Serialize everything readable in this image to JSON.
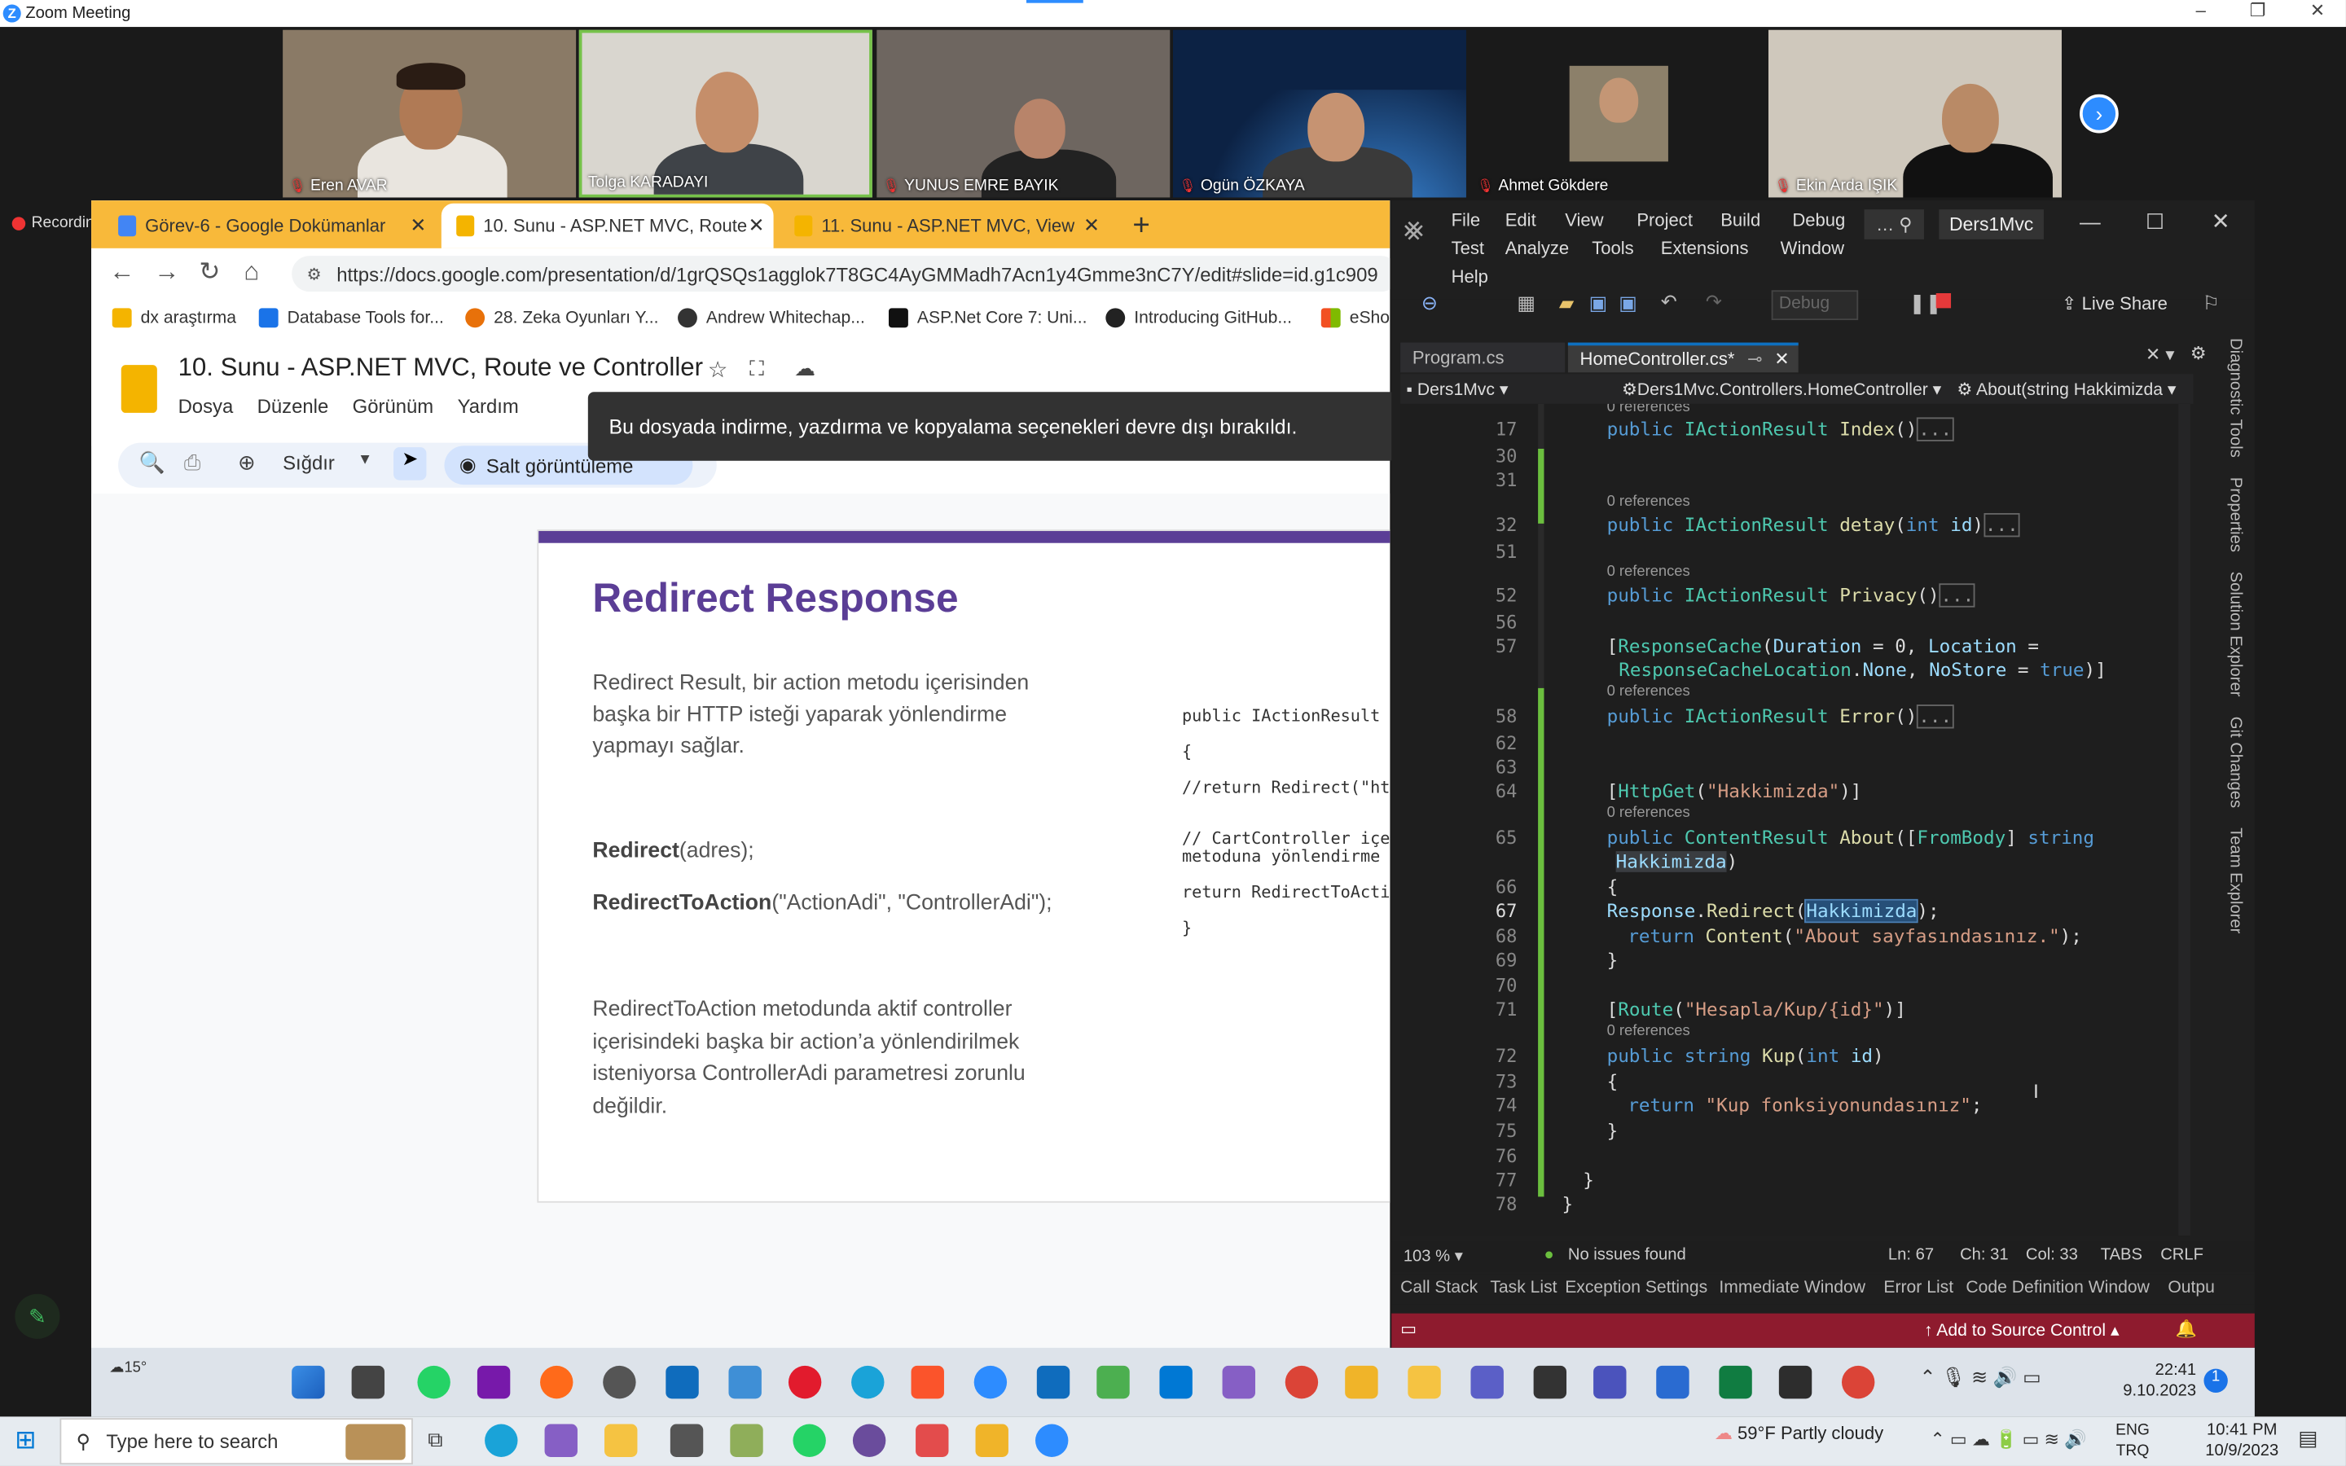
{
  "zoom": {
    "title": "Zoom Meeting",
    "recording": "Recording",
    "participants": [
      "Eren AVAR",
      "Tolga KARADAYI",
      "YUNUS EMRE BAYIK",
      "Ogün ÖZKAYA",
      "Ahmet Gökdere",
      "Ekin Arda IŞIK"
    ]
  },
  "browser": {
    "tabs": [
      "Görev-6 - Google Dokümanlar",
      "10. Sunu - ASP.NET MVC, Route",
      "11. Sunu - ASP.NET MVC, View"
    ],
    "url": "https://docs.google.com/presentation/d/1grQSQs1agglok7T8GC4AyGMMadh7Acn1y4Gmme3nC7Y/edit#slide=id.g1c909",
    "bookmarks": [
      "dx araştırma",
      "Database Tools for...",
      "28. Zeka Oyunları Y...",
      "Andrew Whitechap...",
      "ASP.Net Core 7: Uni...",
      "Introducing GitHub...",
      "eSho"
    ],
    "doc_title": "10. Sunu - ASP.NET MVC, Route ve Controller",
    "menu": [
      "Dosya",
      "Düzenle",
      "Görünüm",
      "Yardım"
    ],
    "zoom_fit": "Sığdır",
    "view_only": "Salt görüntüleme",
    "toast": "Bu dosyada indirme, yazdırma ve kopyalama seçenekleri devre dışı bırakıldı."
  },
  "slide": {
    "title": "Redirect Response",
    "p1": [
      "Redirect Result, bir action metodu içerisinden",
      "başka bir HTTP isteği yaparak yönlendirme",
      "yapmayı sağlar."
    ],
    "l1_b": "Redirect",
    "l1_r": "(adres);",
    "l2_b": "RedirectToAction",
    "l2_r": "(\"ActionAdi\", \"ControllerAdi\");",
    "p2": [
      "RedirectToAction metodunda aktif controller",
      "içerisindeki başka bir action’a yönlendirilmek",
      "isteniyorsa ControllerAdi parametresi zorunlu",
      "değildir."
    ],
    "code": [
      "public IActionResult",
      "{",
      "//return Redirect(\"ht",
      "// CartController içe",
      "metoduna yönlendirme",
      "return RedirectToActi",
      "}"
    ]
  },
  "vs": {
    "menu": [
      "File",
      "Edit",
      "View",
      "Project",
      "Build",
      "Debug",
      "Test",
      "Analyze",
      "Tools",
      "Extensions",
      "Window",
      "Help"
    ],
    "solution": "Ders1Mvc",
    "config": "Debug",
    "live_share": "Live Share",
    "tabs": [
      "Program.cs",
      "HomeController.cs*"
    ],
    "nav": [
      "Ders1Mvc",
      "Ders1Mvc.Controllers.HomeController",
      "About(string Hakkimizda"
    ],
    "side": [
      "Diagnostic Tools",
      "Properties",
      "Solution Explorer",
      "Git Changes",
      "Team Explorer"
    ],
    "ref": "0 references",
    "lines": [
      "17",
      "30",
      "31",
      "32",
      "51",
      "52",
      "56",
      "57",
      "",
      "58",
      "62",
      "63",
      "64",
      "65",
      "",
      "66",
      "67",
      "68",
      "69",
      "70",
      "71",
      "72",
      "73",
      "74",
      "75",
      "76",
      "77",
      "78"
    ],
    "zoom": "103 %",
    "issues": "No issues found",
    "ln": "Ln: 67",
    "ch": "Ch: 31",
    "col": "Col: 33",
    "tabs_mode": "TABS",
    "eol": "CRLF",
    "bottom_tabs": [
      "Call Stack",
      "Task List",
      "Exception Settings",
      "Immediate Window",
      "Error List",
      "Code Definition Window",
      "Outpu"
    ],
    "source_control": "Add to Source Control",
    "code": {
      "l17": "public IActionResult Index()",
      "l32": "public IActionResult detay(int id)",
      "l52": "public IActionResult Privacy()",
      "l57a": "[ResponseCache(Duration = 0, Location =",
      "l57b": "ResponseCacheLocation.None, NoStore = true)]",
      "l58": "public IActionResult Error()",
      "l64": "[HttpGet(\"Hakkimizda\")]",
      "l65a": "public ContentResult About([FromBody] string",
      "l65b": "Hakkimizda)",
      "l66": "{",
      "l67": "Response.Redirect(Hakkimizda);",
      "l68": "return Content(\"About sayfasındasınız.\");",
      "l69": "}",
      "l71": "[Route(\"Hesapla/Kup/{id}\")]",
      "l72": "public string Kup(int id)",
      "l73": "{",
      "l74": "return \"Kup fonksiyonundasınız\";",
      "l75": "}",
      "l77": "}",
      "l78": "}"
    }
  },
  "tray": {
    "weather_temp": "15°",
    "time1": "22:41",
    "date1": "9.10.2023",
    "lang": "ENG",
    "lang2": "TRQ",
    "search": "Type here to search",
    "weather2": "59°F Partly cloudy",
    "time2": "10:41 PM",
    "date2": "10/9/2023"
  }
}
